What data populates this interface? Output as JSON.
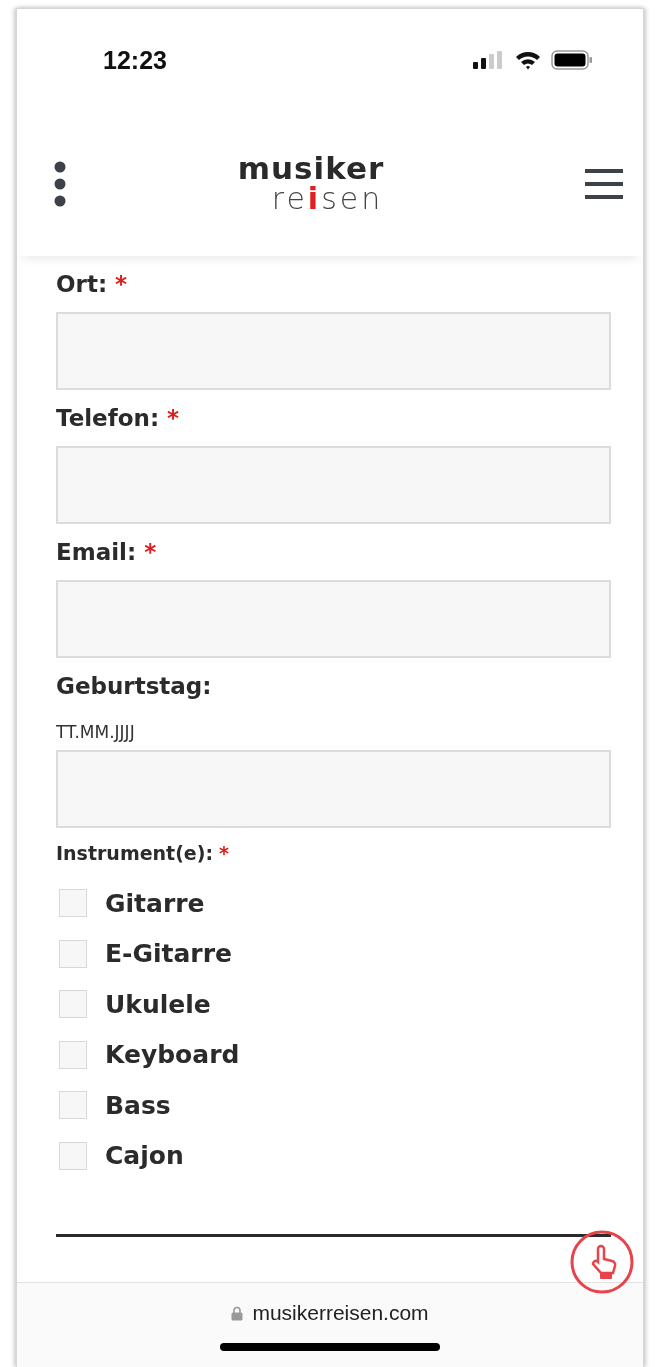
{
  "status_bar": {
    "time": "12:23"
  },
  "header": {
    "logo": {
      "top": "musiker",
      "bottom": "reisen"
    }
  },
  "fields": [
    {
      "label": "Ort:",
      "required_mark": "*"
    },
    {
      "label": "Telefon:",
      "required_mark": "*"
    },
    {
      "label": "Email:",
      "required_mark": "*"
    },
    {
      "label": "Geburtstag:",
      "hint": "TT.MM.JJJJ"
    }
  ],
  "instruments": {
    "label": "Instrument(e):",
    "required_mark": "*",
    "options": [
      {
        "label": "Gitarre",
        "checked": false
      },
      {
        "label": "E-Gitarre",
        "checked": false
      },
      {
        "label": "Ukulele",
        "checked": false
      },
      {
        "label": "Keyboard",
        "checked": false
      },
      {
        "label": "Bass",
        "checked": false
      },
      {
        "label": "Cajon",
        "checked": false
      }
    ]
  },
  "address_bar": {
    "url": "musikerreisen.com"
  }
}
